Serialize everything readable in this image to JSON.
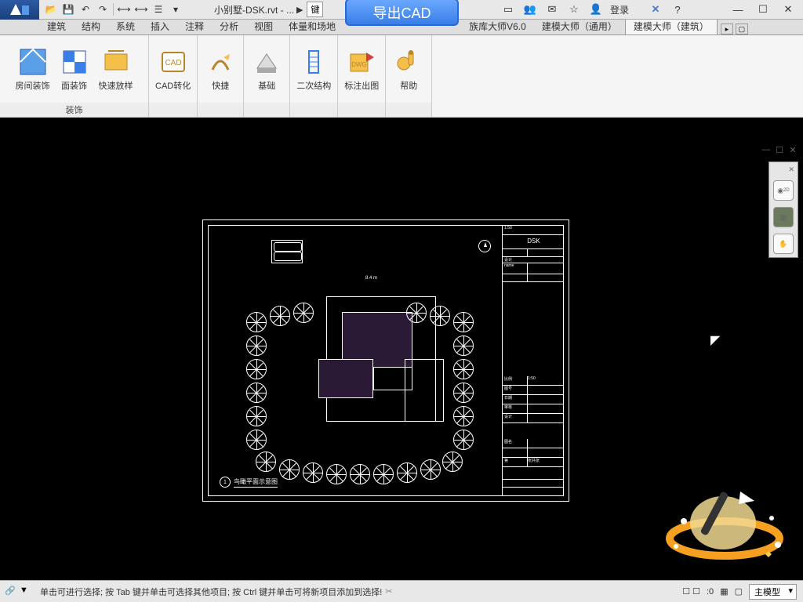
{
  "title": {
    "filename": "小别墅-DSK.rvt - ...",
    "arrow": "▶",
    "keyhint": "键"
  },
  "cad_button": "导出CAD",
  "login_label": "登录",
  "tabs": [
    "建筑",
    "结构",
    "系统",
    "插入",
    "注释",
    "分析",
    "视图",
    "体量和场地",
    "",
    "",
    "族库大师V6.0",
    "建模大师（通用）",
    "建模大师（建筑）"
  ],
  "active_tab_index": 12,
  "ribbon": {
    "panel_deco": {
      "label": "装饰",
      "buttons": [
        "房间装饰",
        "面装饰",
        "快速放样"
      ]
    },
    "buttons": [
      "CAD转化",
      "快捷",
      "基础",
      "二次结构",
      "标注出图",
      "帮助"
    ]
  },
  "drawing": {
    "title_number": "1",
    "title_text": "鸟瞰平面示意图",
    "titleblock_main": "DSK"
  },
  "statusbar": {
    "hint": "单击可进行选择; 按 Tab 键并单击可选择其他项目; 按 Ctrl 键并单击可将新项目添加到选择!",
    "zoom": ":0",
    "view_selector": "主模型"
  },
  "titleright": {
    "icons": [
      "⌕",
      "|",
      "👥",
      "✉",
      "☆",
      "👤"
    ],
    "help": "?",
    "x": "✕"
  }
}
